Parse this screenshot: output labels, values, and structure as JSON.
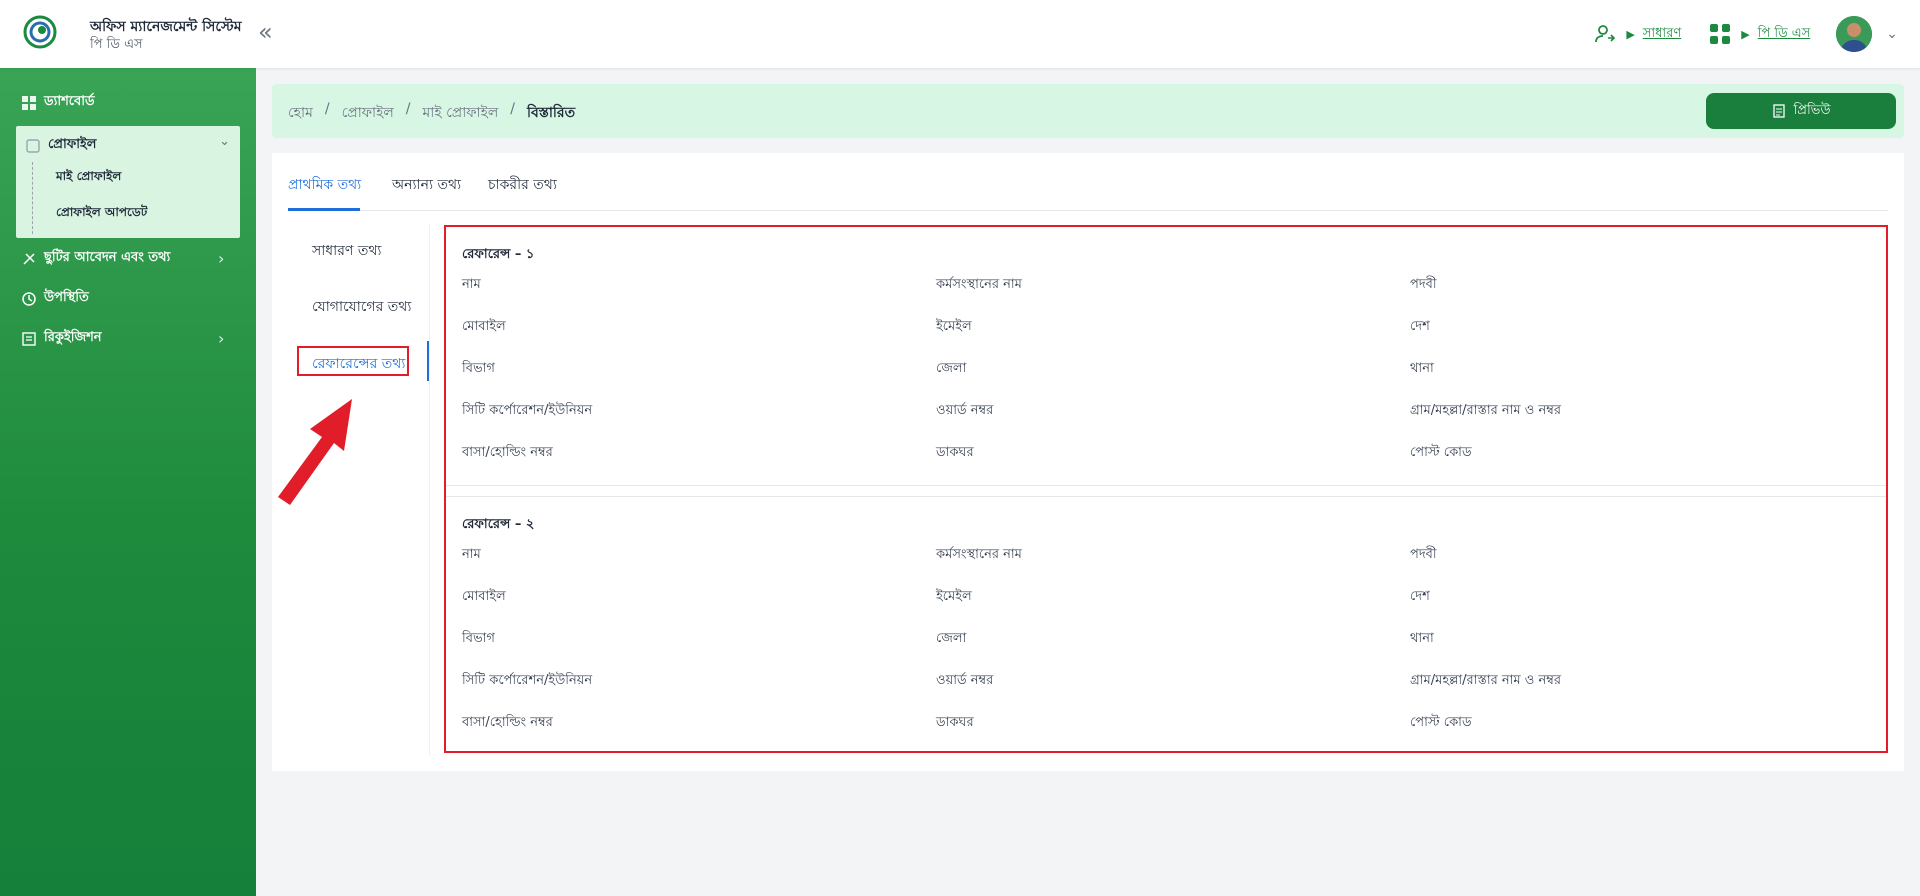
{
  "app": {
    "title": "অফিস ম্যানেজমেন্ট সিস্টেম",
    "subtitle": "পি ডি এস",
    "collapse_glyph": "«",
    "brand_color": "#1a8a3f",
    "accent_color": "#1e6fd9",
    "highlight_color": "#e11d2a"
  },
  "header": {
    "role_icon": "user-switch-icon",
    "role_label": "সাধারণ",
    "module_icon": "apps-grid-icon",
    "module_label": "পি ডি এস",
    "avatar_icon": "avatar",
    "menu_chevron": "chevron-down-icon"
  },
  "sidebar": {
    "items": [
      {
        "label": "ড্যাশবোর্ড",
        "icon": "dashboard-icon"
      },
      {
        "label": "প্রোফাইল",
        "icon": "profile-icon"
      },
      {
        "label": "ছুটির আবেদন এবং তথ্য",
        "icon": "leave-icon"
      },
      {
        "label": "উপস্থিতি",
        "icon": "clock-icon"
      },
      {
        "label": "রিকুইজিশন",
        "icon": "requisition-icon"
      }
    ],
    "profile_sub": [
      "মাই প্রোফাইল",
      "প্রোফাইল আপডেট"
    ]
  },
  "breadcrumb": [
    "হোম",
    "প্রোফাইল",
    "মাই প্রোফাইল",
    "বিস্তারিত"
  ],
  "breadcrumb_sep": "/",
  "preview_button": {
    "label": "প্রিভিউ",
    "icon": "document-icon"
  },
  "tabs": [
    "প্রাথমিক তথ্য",
    "অন্যান্য তথ্য",
    "চাকরীর তথ্য"
  ],
  "side_nav": [
    "সাধারণ তথ্য",
    "যোগাযোগের তথ্য",
    "রেফারেন্সের তথ্য"
  ],
  "references": [
    {
      "title": "রেফারেন্স – ১",
      "rows": [
        [
          "নাম",
          "কর্মসংস্থানের নাম",
          "পদবী"
        ],
        [
          "মোবাইল",
          "ইমেইল",
          "দেশ"
        ],
        [
          "বিভাগ",
          "জেলা",
          "থানা"
        ],
        [
          "সিটি কর্পোরেশন/ইউনিয়ন",
          "ওয়ার্ড নম্বর",
          "গ্রাম/মহল্লা/রাস্তার নাম ও নম্বর"
        ],
        [
          "বাসা/হোল্ডিং নম্বর",
          "ডাকঘর",
          "পোস্ট কোড"
        ]
      ]
    },
    {
      "title": "রেফারেন্স – ২",
      "rows": [
        [
          "নাম",
          "কর্মসংস্থানের নাম",
          "পদবী"
        ],
        [
          "মোবাইল",
          "ইমেইল",
          "দেশ"
        ],
        [
          "বিভাগ",
          "জেলা",
          "থানা"
        ],
        [
          "সিটি কর্পোরেশন/ইউনিয়ন",
          "ওয়ার্ড নম্বর",
          "গ্রাম/মহল্লা/রাস্তার নাম ও নম্বর"
        ],
        [
          "বাসা/হোল্ডিং নম্বর",
          "ডাকঘর",
          "পোস্ট কোড"
        ]
      ]
    }
  ]
}
